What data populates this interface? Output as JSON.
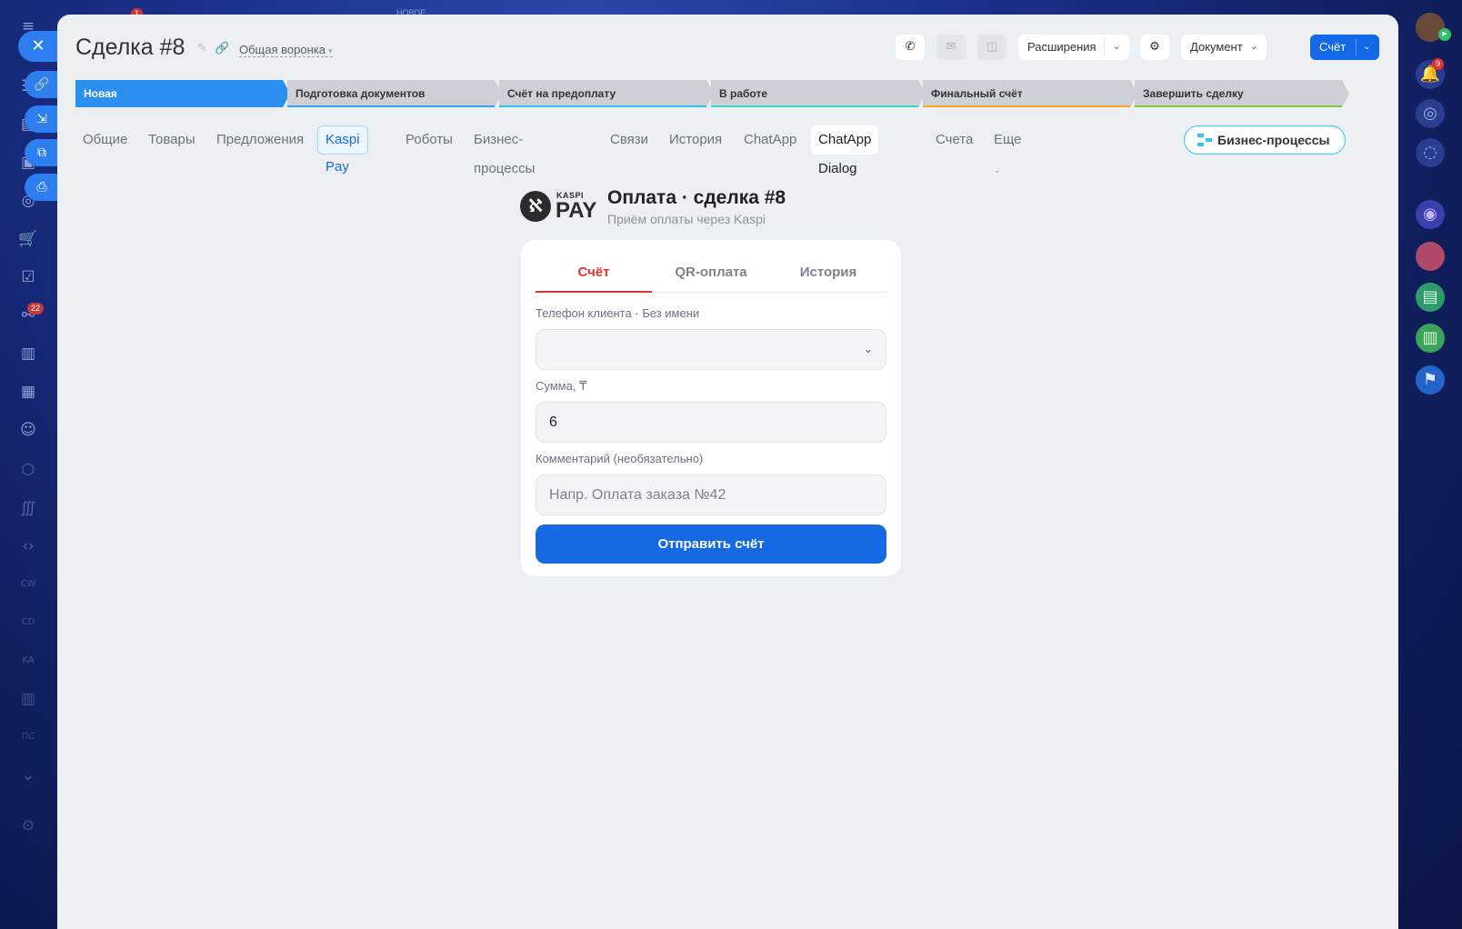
{
  "deal": {
    "title": "Сделка #8",
    "funnel": "Общая воронка"
  },
  "toolbar": {
    "extensions": "Расширения",
    "document": "Документ",
    "invoice": "Счёт"
  },
  "stages": [
    {
      "label": "Новая",
      "color": "#2b8ff0",
      "bar": "#2b8ff0"
    },
    {
      "label": "Подготовка документов",
      "color": "#cdd1d7",
      "bar": "#3aa3e8"
    },
    {
      "label": "Счёт на предоплату",
      "color": "#cdd1d7",
      "bar": "#37c0e8"
    },
    {
      "label": "В работе",
      "color": "#cdd1d7",
      "bar": "#3bd6c6"
    },
    {
      "label": "Финальный счёт",
      "color": "#cdd1d7",
      "bar": "#f5a623"
    },
    {
      "label": "Завершить сделку",
      "color": "#cdd1d7",
      "bar": "#7fc63b"
    }
  ],
  "tabs": {
    "general": "Общие",
    "products": "Товары",
    "offers": "Предложения",
    "kaspi": "Kaspi Pay",
    "robots": "Роботы",
    "bp": "Бизнес-процессы",
    "links": "Связи",
    "history": "История",
    "chatapp": "ChatApp",
    "chatapp_dialog": "ChatApp Dialog",
    "invoices": "Счета",
    "more": "Еще"
  },
  "bp_button": "Бизнес-процессы",
  "badges": {
    "left_top": "1",
    "left_mid": "22",
    "notifications": "9"
  },
  "kaspi": {
    "logo_small": "KASPI",
    "logo_big": "PAY",
    "title": "Оплата · сделка #8",
    "subtitle": "Приём оплаты через Kaspi",
    "tabs": [
      "Счёт",
      "QR-оплата",
      "История"
    ],
    "phone_label": "Телефон клиента · Без имени",
    "phone_value": "",
    "amount_label": "Сумма, ₸",
    "amount_value": "6",
    "comment_label": "Комментарий (необязательно)",
    "comment_placeholder": "Напр. Оплата заказа №42",
    "send": "Отправить счёт"
  },
  "top_hint": "НОВОЕ"
}
